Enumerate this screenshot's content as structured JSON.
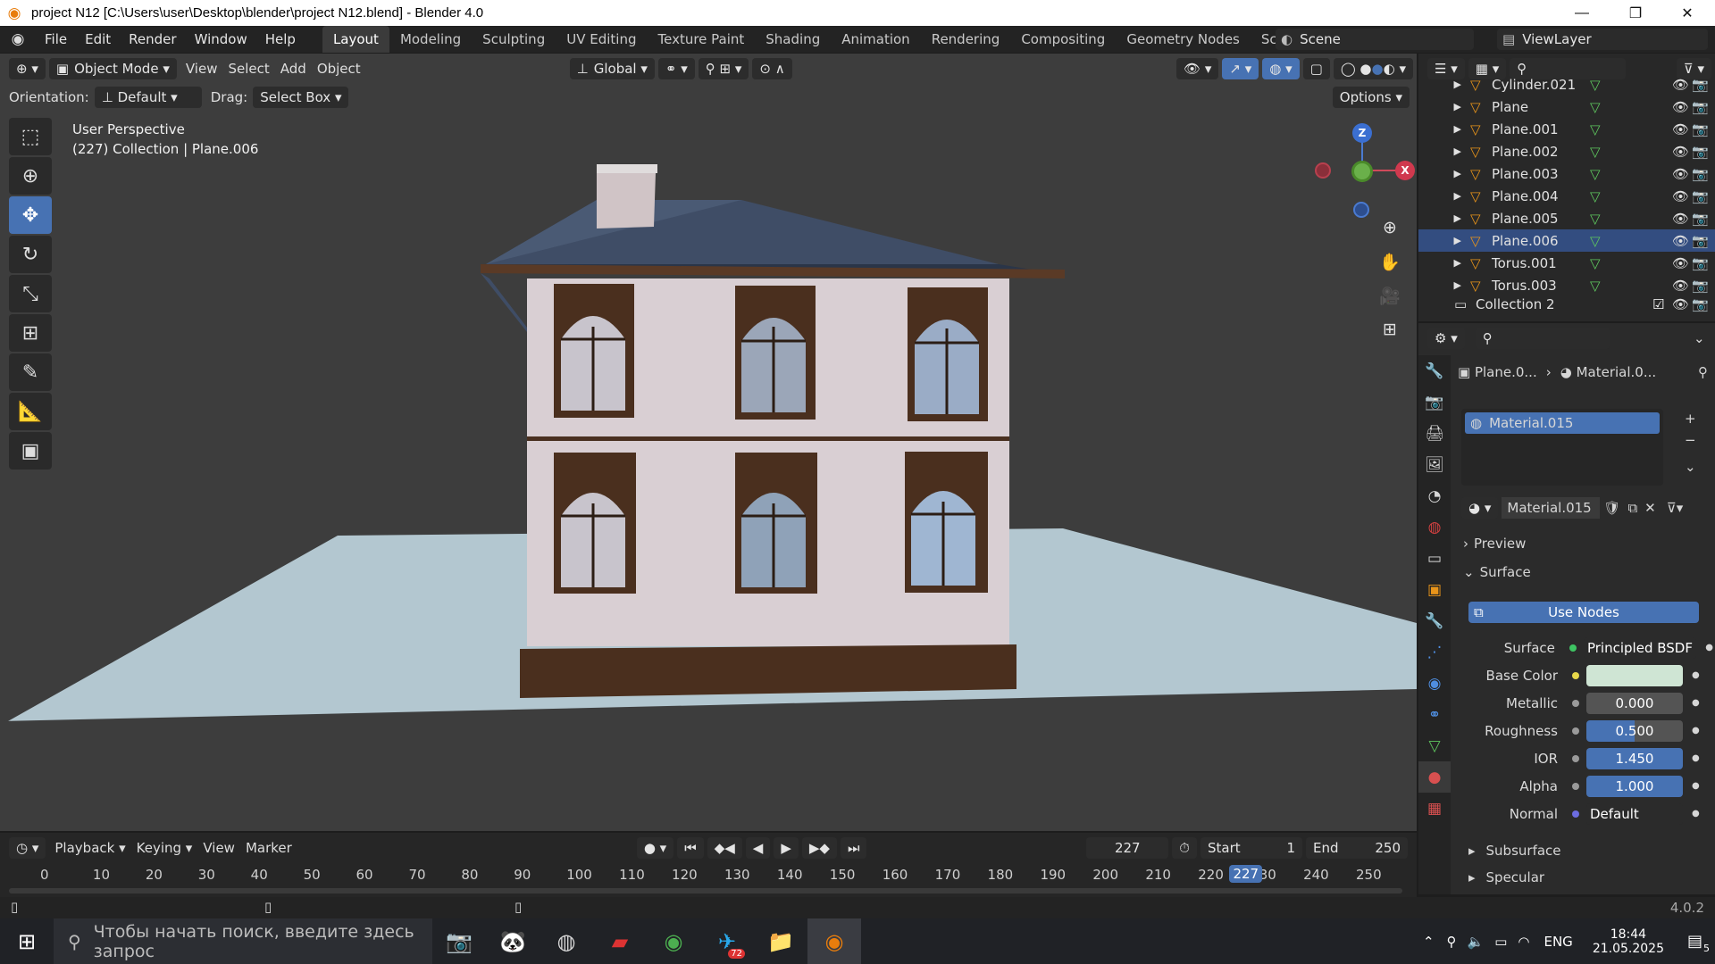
{
  "titlebar": {
    "title": "project N12 [C:\\Users\\user\\Desktop\\blender\\project N12.blend] - Blender 4.0",
    "minimize": "—",
    "maximize": "❐",
    "close": "✕"
  },
  "menu": [
    "File",
    "Edit",
    "Render",
    "Window",
    "Help"
  ],
  "workspaces": [
    "Layout",
    "Modeling",
    "Sculpting",
    "UV Editing",
    "Texture Paint",
    "Shading",
    "Animation",
    "Rendering",
    "Compositing",
    "Geometry Nodes",
    "Scripting"
  ],
  "workspace_add": "+",
  "scene": {
    "label": "Scene",
    "view_layer": "ViewLayer"
  },
  "viewport": {
    "mode": "Object Mode",
    "menus": [
      "View",
      "Select",
      "Add",
      "Object"
    ],
    "transform_orientation": "Global",
    "orientation_label": "Orientation:",
    "orientation_value": "Default",
    "drag_label": "Drag:",
    "drag_value": "Select Box",
    "options": "Options",
    "perspective": "User Perspective",
    "collection_info": "(227) Collection | Plane.006",
    "gizmo": {
      "z": "Z",
      "x": "X"
    }
  },
  "outliner": {
    "items": [
      {
        "name": "Cylinder.021",
        "partial": true
      },
      {
        "name": "Plane"
      },
      {
        "name": "Plane.001"
      },
      {
        "name": "Plane.002"
      },
      {
        "name": "Plane.003"
      },
      {
        "name": "Plane.004"
      },
      {
        "name": "Plane.005"
      },
      {
        "name": "Plane.006",
        "selected": true
      },
      {
        "name": "Torus.001"
      },
      {
        "name": "Torus.003"
      }
    ],
    "collection2": "Collection 2"
  },
  "properties": {
    "breadcrumb_object": "Plane.0...",
    "breadcrumb_material": "Material.0...",
    "slot": "Material.015",
    "material_name": "Material.015",
    "preview": "Preview",
    "surface_panel": "Surface",
    "use_nodes": "Use Nodes",
    "rows": [
      {
        "label": "Surface",
        "value": "Principled BSDF",
        "type": "shader"
      },
      {
        "label": "Base Color",
        "value": "",
        "type": "color",
        "color": "#cfe5d4"
      },
      {
        "label": "Metallic",
        "value": "0.000",
        "type": "num",
        "fill": 0.0
      },
      {
        "label": "Roughness",
        "value": "0.500",
        "type": "num",
        "fill": 0.5
      },
      {
        "label": "IOR",
        "value": "1.450",
        "type": "num",
        "fill": 1.0
      },
      {
        "label": "Alpha",
        "value": "1.000",
        "type": "num",
        "fill": 1.0
      },
      {
        "label": "Normal",
        "value": "Default",
        "type": "link"
      }
    ],
    "subsurface": "Subsurface",
    "specular": "Specular"
  },
  "timeline": {
    "menus": [
      "Playback",
      "Keying",
      "View",
      "Marker"
    ],
    "current_frame": "227",
    "start_label": "Start",
    "start": "1",
    "end_label": "End",
    "end": "250",
    "ticks": [
      "0",
      "10",
      "20",
      "30",
      "40",
      "50",
      "60",
      "70",
      "80",
      "90",
      "100",
      "110",
      "120",
      "130",
      "140",
      "150",
      "160",
      "170",
      "180",
      "190",
      "200",
      "210",
      "220",
      "230",
      "240",
      "250"
    ],
    "playhead": "227"
  },
  "status": {
    "version": "4.0.2"
  },
  "taskbar": {
    "search_placeholder": "Чтобы начать поиск, введите здесь запрос",
    "lang": "ENG",
    "time": "18:44",
    "date": "21.05.2025",
    "notif": "5",
    "telegram_badge": "72"
  },
  "colors": {
    "accent": "#4772b3",
    "orange": "#e87d0d",
    "selected_row": "#334d80"
  }
}
